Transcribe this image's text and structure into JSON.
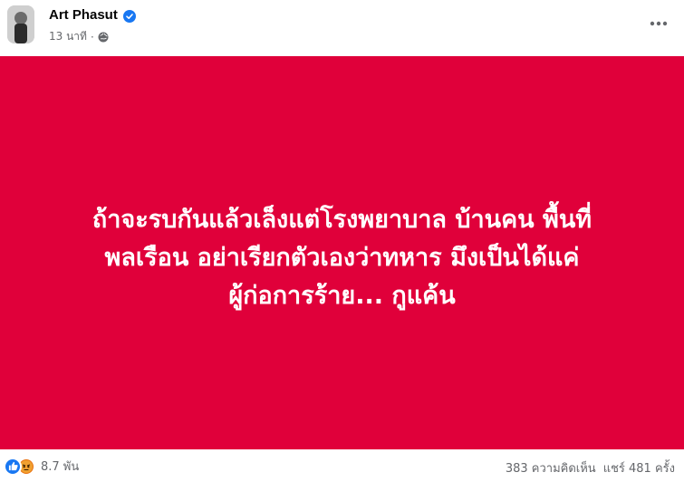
{
  "author": {
    "name": "Art Phasut",
    "verified": true
  },
  "meta": {
    "time": "13 นาที",
    "separator": "·",
    "privacy_icon": "globe-icon"
  },
  "post": {
    "background_color": "#e0003a",
    "text_color": "#ffffff",
    "lines": [
      "ถ้าจะรบกันแล้วเล็งแต่โรงพยาบาล บ้านคน พื้นที่",
      "พลเรือน อย่าเรียกตัวเองว่าทหาร มึงเป็นได้แค่",
      "ผู้ก่อการร้าย... กูแค้น"
    ]
  },
  "footer": {
    "reactions": [
      "like-icon",
      "angry-icon"
    ],
    "reaction_count": "8.7 พัน",
    "comments": "383 ความคิดเห็น",
    "shares": "แชร์ 481 ครั้ง"
  },
  "colors": {
    "accent_blue": "#1877f2",
    "muted_text": "#65676b"
  }
}
